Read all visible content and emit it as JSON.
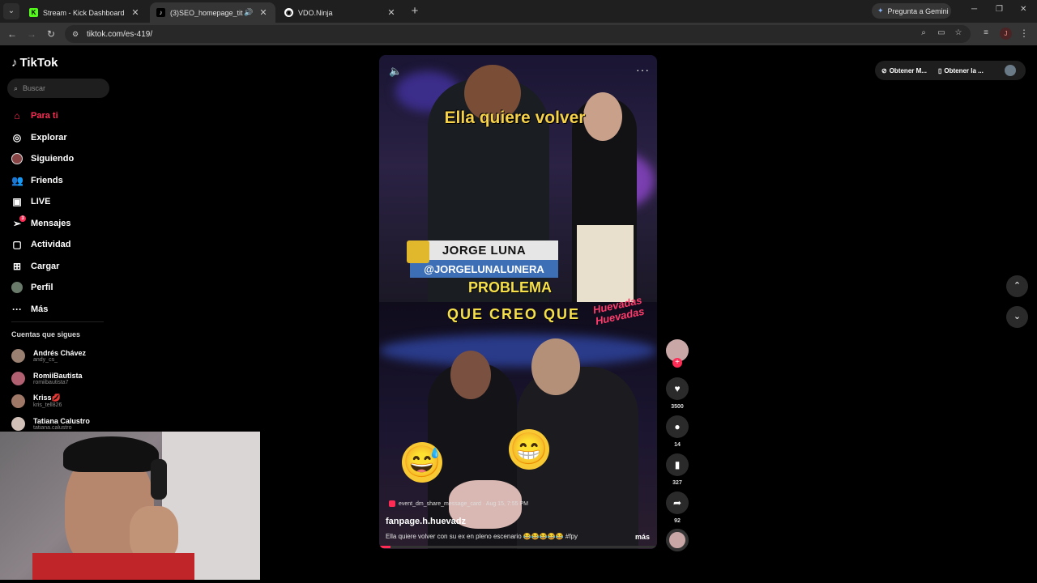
{
  "browser": {
    "tabs": [
      {
        "title": "Stream - Kick Dashboard",
        "favicon": "K",
        "favicon_color": "#53fc18",
        "active": false
      },
      {
        "title": "(3)SEO_homepage_title",
        "favicon": "♪",
        "favicon_color": "#000000",
        "active": true
      },
      {
        "title": "VDO.Ninja",
        "favicon": "◉",
        "favicon_color": "#ffffff",
        "active": false
      }
    ],
    "gemini_label": "Pregunta a Gemini",
    "url": "tiktok.com/es-419/",
    "profile_initial": "J"
  },
  "tiktok": {
    "logo_text": "TikTok",
    "search_placeholder": "Buscar",
    "nav": [
      {
        "label": "Para ti",
        "icon": "home-icon",
        "active": true
      },
      {
        "label": "Explorar",
        "icon": "compass-icon"
      },
      {
        "label": "Siguiendo",
        "icon": "following-avatar-icon"
      },
      {
        "label": "Friends",
        "icon": "friends-icon"
      },
      {
        "label": "LIVE",
        "icon": "live-icon"
      },
      {
        "label": "Mensajes",
        "icon": "messages-icon",
        "badge": "3"
      },
      {
        "label": "Actividad",
        "icon": "activity-icon"
      },
      {
        "label": "Cargar",
        "icon": "upload-icon"
      },
      {
        "label": "Perfil",
        "icon": "profile-icon"
      },
      {
        "label": "Más",
        "icon": "more-icon"
      }
    ],
    "following_title": "Cuentas que sigues",
    "following": [
      {
        "name": "Andrés Chávez",
        "handle": "andy_cs_"
      },
      {
        "name": "RomiiBautista",
        "handle": "romiibautista7"
      },
      {
        "name": "Kriss💋",
        "handle": "kris_tell826"
      },
      {
        "name": "Tatiana Calustro",
        "handle": "tatiana.calustro"
      }
    ],
    "top_right": {
      "btn1": "Obtener M...",
      "btn2": "Obtener la ..."
    },
    "video": {
      "caption_top": "Ella quiere volver",
      "lower_third_name": "JORGE LUNA",
      "lower_third_handle": "@JORGELUNALUNERA",
      "caption_mid": "PROBLEMA",
      "caption_bottom": "QUE CREO QUE",
      "stamp": "Huevadas Huevadas",
      "emoji_left": "😅",
      "emoji_right": "😁",
      "meta_tag": "event_dm_share_message_card · Aug 15, 7:55 PM",
      "author": "fanpage.h.huevadz",
      "description": "Ella quiere volver con su ex en pleno escenario 😂😂😂😂😂 #fpy",
      "more_label": "más",
      "progress": 0.04
    },
    "actions": {
      "likes": "3500",
      "comments": "14",
      "saves": "327",
      "shares": "92"
    }
  }
}
